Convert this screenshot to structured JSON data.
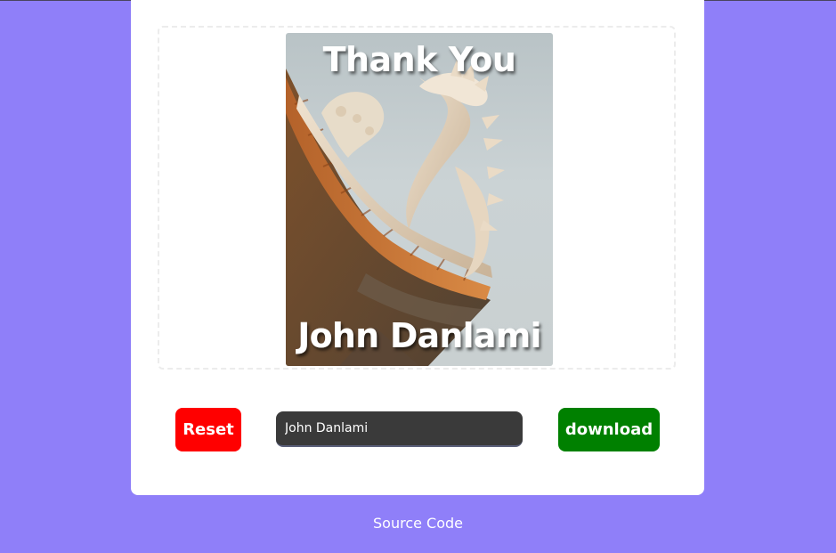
{
  "card_preview": {
    "title": "Thank You",
    "name": "John Danlami",
    "image_subject": "dragon-roof-sculpture"
  },
  "controls": {
    "reset_label": "Reset",
    "name_value": "John Danlami",
    "download_label": "download"
  },
  "footer": {
    "source_link": "Source Code"
  },
  "colors": {
    "page_background": "#8f7ff9",
    "card_background": "#ffffff",
    "reset": "#ff0000",
    "download": "#008000",
    "input_background": "#3a3a3a"
  }
}
